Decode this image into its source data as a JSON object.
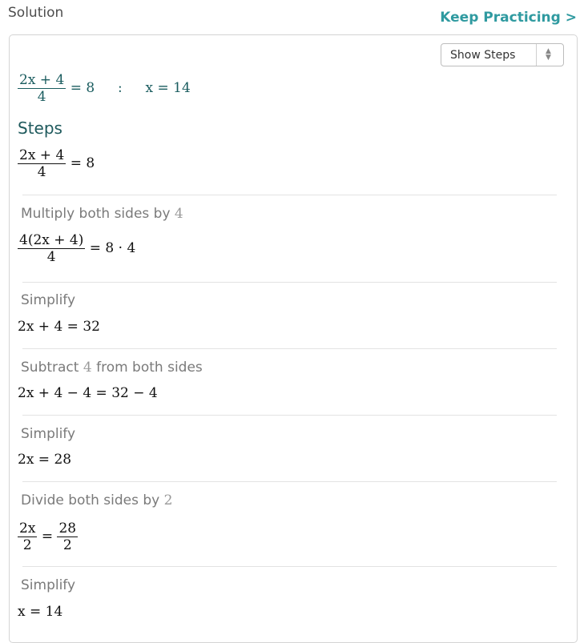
{
  "header": {
    "title": "Solution",
    "keep_practicing": "Keep Practicing >"
  },
  "show_steps_select": {
    "value": "Show Steps"
  },
  "answer": {
    "numerator": "2x + 4",
    "denominator": "4",
    "rhs": "= 8",
    "colon": ":",
    "solution": "x = 14"
  },
  "steps_heading": "Steps",
  "step0": {
    "numerator": "2x + 4",
    "denominator": "4",
    "rhs": "= 8"
  },
  "step1": {
    "label": "Multiply both sides by",
    "label_num": "4",
    "numerator": "4(2x + 4)",
    "denominator": "4",
    "rhs": "= 8 · 4"
  },
  "step2": {
    "label": "Simplify",
    "eq": "2x + 4 = 32"
  },
  "step3": {
    "label_pre": "Subtract",
    "label_num": "4",
    "label_post": "from both sides",
    "eq": "2x + 4 − 4 = 32 − 4"
  },
  "step4": {
    "label": "Simplify",
    "eq": "2x = 28"
  },
  "step5": {
    "label": "Divide both sides by",
    "label_num": "2",
    "lhs_num": "2x",
    "lhs_den": "2",
    "eq_sign": "=",
    "rhs_num": "28",
    "rhs_den": "2"
  },
  "step6": {
    "label": "Simplify",
    "eq": "x = 14"
  }
}
